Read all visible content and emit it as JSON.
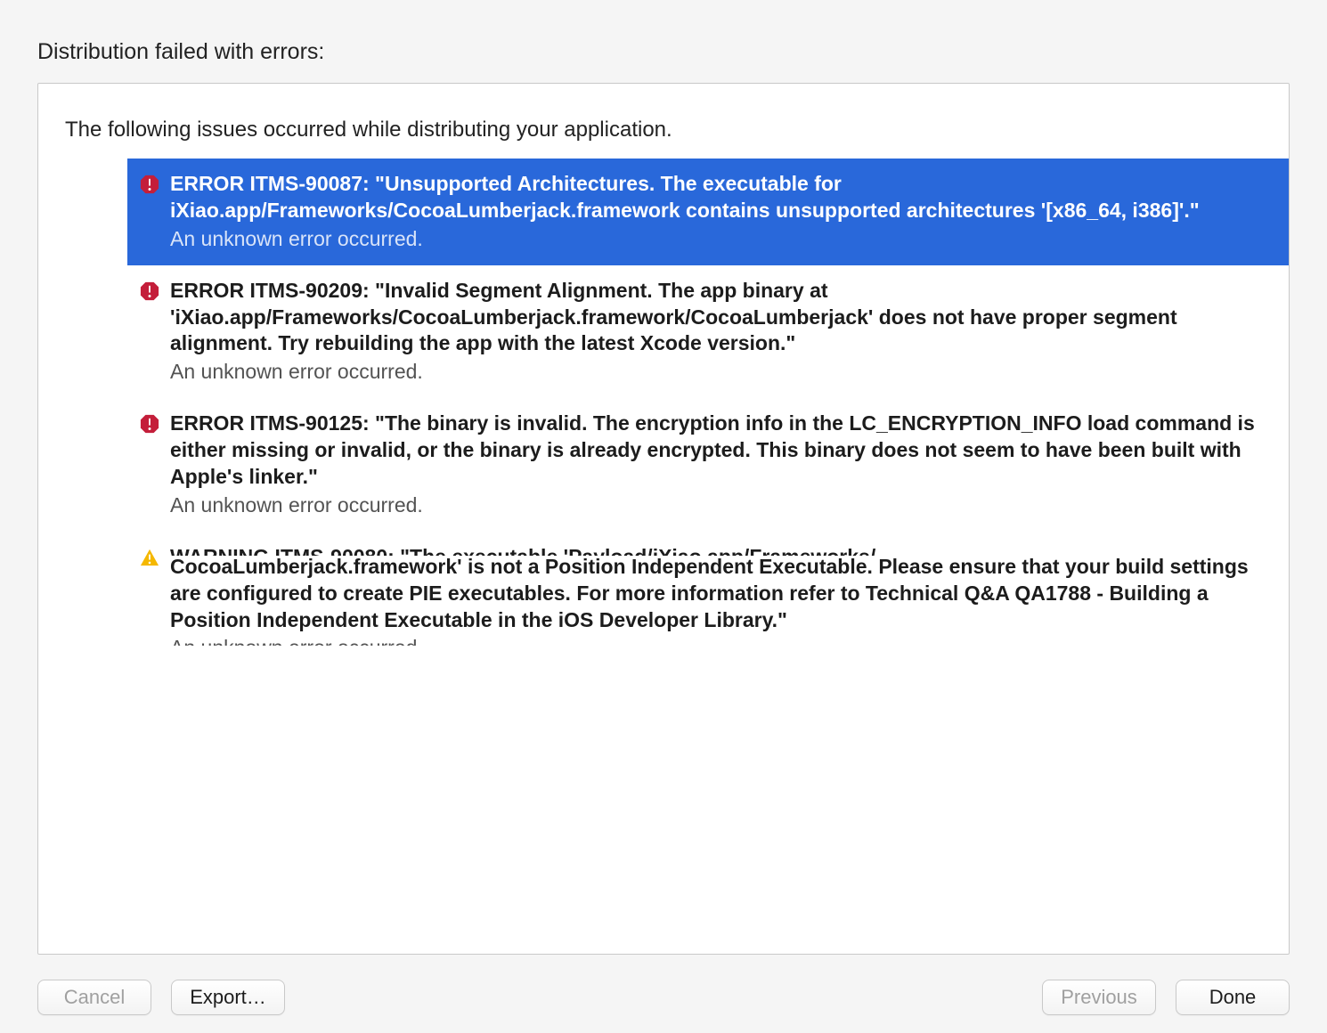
{
  "heading": "Distribution failed with errors:",
  "intro": "The following issues occurred while distributing your application.",
  "issues": [
    {
      "type": "error",
      "selected": true,
      "title": "ERROR ITMS-90087: \"Unsupported Architectures. The executable for iXiao.app/Frameworks/CocoaLumberjack.framework contains unsupported architectures '[x86_64, i386]'.\"",
      "detail": "An unknown error occurred."
    },
    {
      "type": "error",
      "selected": false,
      "title": "ERROR ITMS-90209: \"Invalid Segment Alignment. The app binary at 'iXiao.app/Frameworks/CocoaLumberjack.framework/CocoaLumberjack' does not have proper segment alignment. Try rebuilding the app with the latest Xcode version.\"",
      "detail": "An unknown error occurred."
    },
    {
      "type": "error",
      "selected": false,
      "title": "ERROR ITMS-90125: \"The binary is invalid. The encryption info in the LC_ENCRYPTION_INFO load command is either missing or invalid, or the binary is already encrypted. This binary does not seem to have been built with Apple's linker.\"",
      "detail": "An unknown error occurred."
    },
    {
      "type": "warning",
      "selected": false,
      "title_line1": "WARNING ITMS-90080: \"The executable 'Payload/iXiao.app/Frameworks/",
      "title_rest": "CocoaLumberjack.framework' is not a Position Independent Executable. Please ensure that your build settings are configured to create PIE executables. For more information refer to Technical Q&A QA1788 - Building a Position Independent Executable in the iOS Developer Library.\"",
      "detail": "An unknown error occurred."
    }
  ],
  "buttons": {
    "cancel": "Cancel",
    "export": "Export…",
    "previous": "Previous",
    "done": "Done"
  }
}
